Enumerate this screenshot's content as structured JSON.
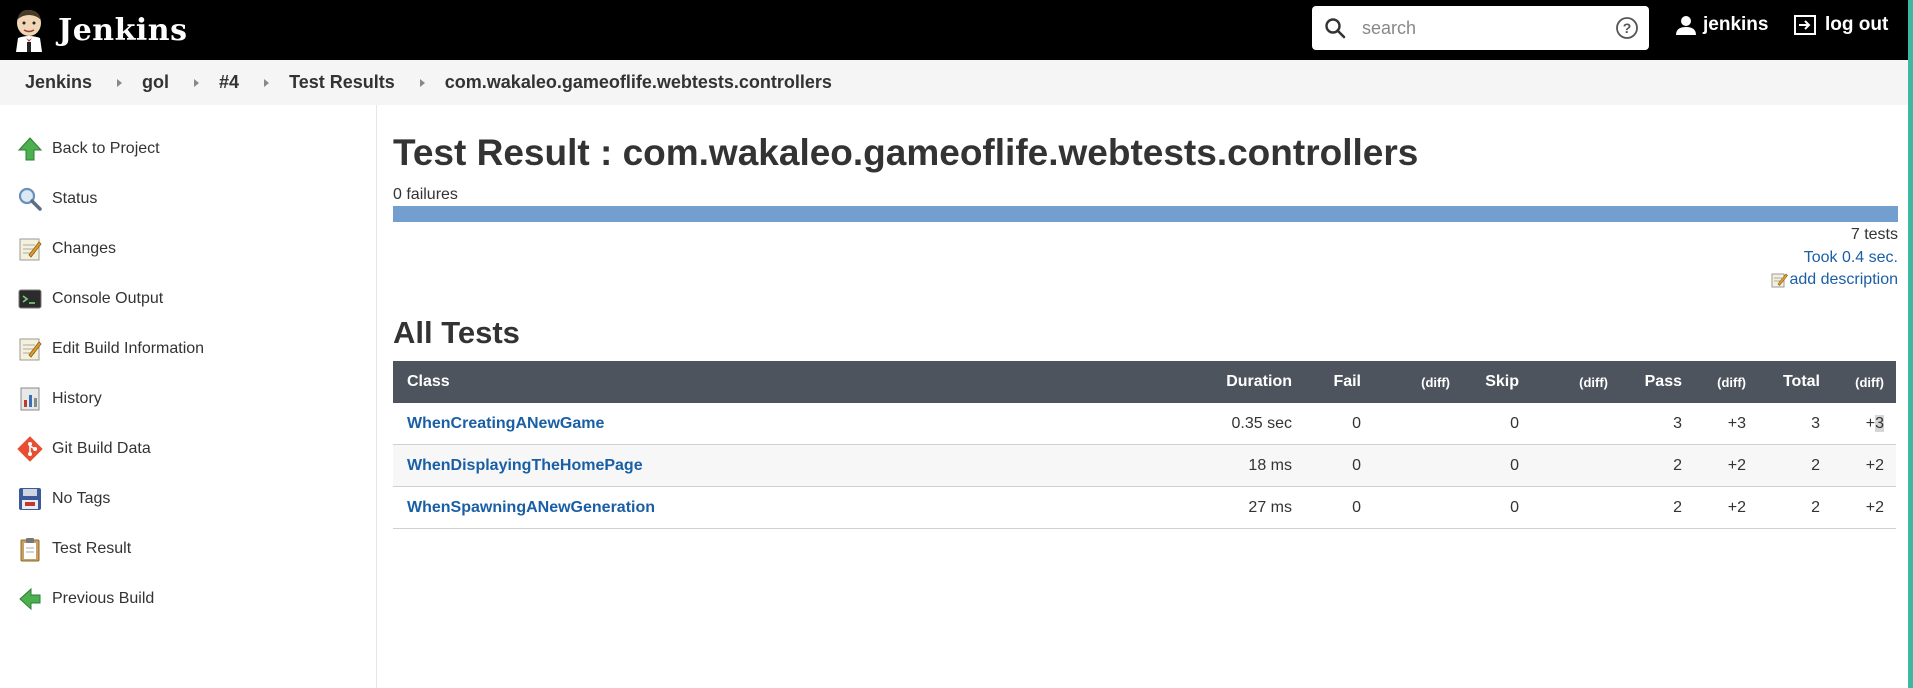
{
  "header": {
    "brand": "Jenkins",
    "search_placeholder": "search",
    "user": "jenkins",
    "logout": "log out"
  },
  "breadcrumb": [
    "Jenkins",
    "gol",
    "#4",
    "Test Results",
    "com.wakaleo.gameoflife.webtests.controllers"
  ],
  "sidebar": {
    "items": [
      {
        "label": "Back to Project",
        "icon": "up-arrow-icon"
      },
      {
        "label": "Status",
        "icon": "magnifier-icon"
      },
      {
        "label": "Changes",
        "icon": "notepad-icon"
      },
      {
        "label": "Console Output",
        "icon": "terminal-icon"
      },
      {
        "label": "Edit Build Information",
        "icon": "notepad-icon"
      },
      {
        "label": "History",
        "icon": "history-icon"
      },
      {
        "label": "Git Build Data",
        "icon": "git-icon"
      },
      {
        "label": "No Tags",
        "icon": "floppy-disk-icon"
      },
      {
        "label": "Test Result",
        "icon": "clipboard-icon"
      },
      {
        "label": "Previous Build",
        "icon": "left-arrow-icon"
      }
    ]
  },
  "main": {
    "title": "Test Result : com.wakaleo.gameoflife.webtests.controllers",
    "failures": "0 failures",
    "pass_fraction": 1.0,
    "tests_count": "7 tests",
    "took": "Took 0.4 sec.",
    "add_description": "add description",
    "section_title": "All Tests"
  },
  "table": {
    "headers": {
      "class": "Class",
      "duration": "Duration",
      "fail": "Fail",
      "fail_diff": "(diff)",
      "skip": "Skip",
      "skip_diff": "(diff)",
      "pass": "Pass",
      "pass_diff": "(diff)",
      "total": "Total",
      "total_diff": "(diff)"
    },
    "rows": [
      {
        "class": "WhenCreatingANewGame",
        "duration": "0.35 sec",
        "fail": "0",
        "fail_diff": "",
        "skip": "0",
        "skip_diff": "",
        "pass": "3",
        "pass_diff": "+3",
        "total": "3",
        "total_diff_a": "+",
        "total_diff_b": "3"
      },
      {
        "class": "WhenDisplayingTheHomePage",
        "duration": "18 ms",
        "fail": "0",
        "fail_diff": "",
        "skip": "0",
        "skip_diff": "",
        "pass": "2",
        "pass_diff": "+2",
        "total": "2",
        "total_diff_a": "+2",
        "total_diff_b": ""
      },
      {
        "class": "WhenSpawningANewGeneration",
        "duration": "27 ms",
        "fail": "0",
        "fail_diff": "",
        "skip": "0",
        "skip_diff": "",
        "pass": "2",
        "pass_diff": "+2",
        "total": "2",
        "total_diff_a": "+2",
        "total_diff_b": ""
      }
    ]
  },
  "colors": {
    "header_bg": "#000000",
    "breadcrumb_bg": "#f5f5f5",
    "link": "#1a5fa6",
    "table_header_bg": "#4d545d",
    "pass_bar": "#729fcf",
    "edge_accent": "#3cb9a0"
  }
}
